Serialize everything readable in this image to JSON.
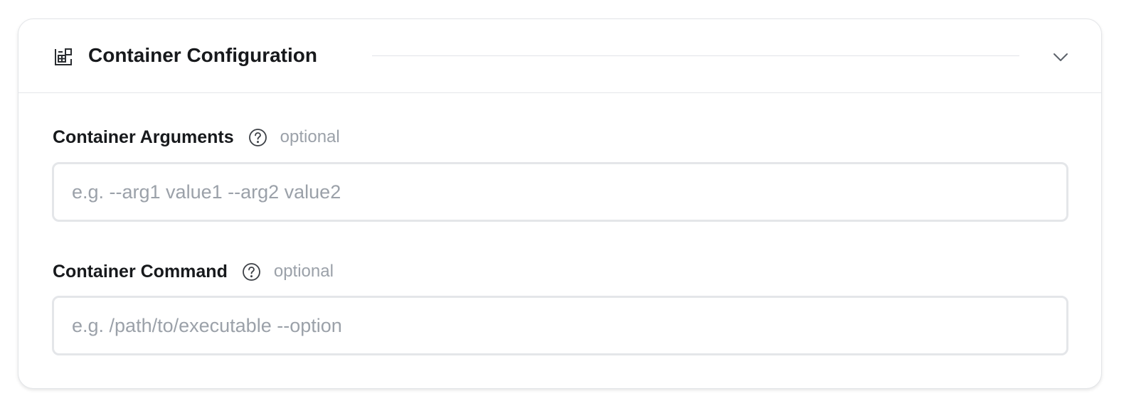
{
  "section": {
    "title": "Container Configuration",
    "icon": "container-config-icon",
    "collapse_icon": "chevron-down-icon"
  },
  "fields": [
    {
      "label": "Container Arguments",
      "help_icon": "question-circle-icon",
      "optional_text": "optional",
      "value": "",
      "placeholder": "e.g. --arg1 value1 --arg2 value2"
    },
    {
      "label": "Container Command",
      "help_icon": "question-circle-icon",
      "optional_text": "optional",
      "value": "",
      "placeholder": "e.g. /path/to/executable --option"
    }
  ],
  "colors": {
    "title_text": "#17191c",
    "muted_text": "#9ba1a9",
    "border": "#e4e6e9"
  }
}
